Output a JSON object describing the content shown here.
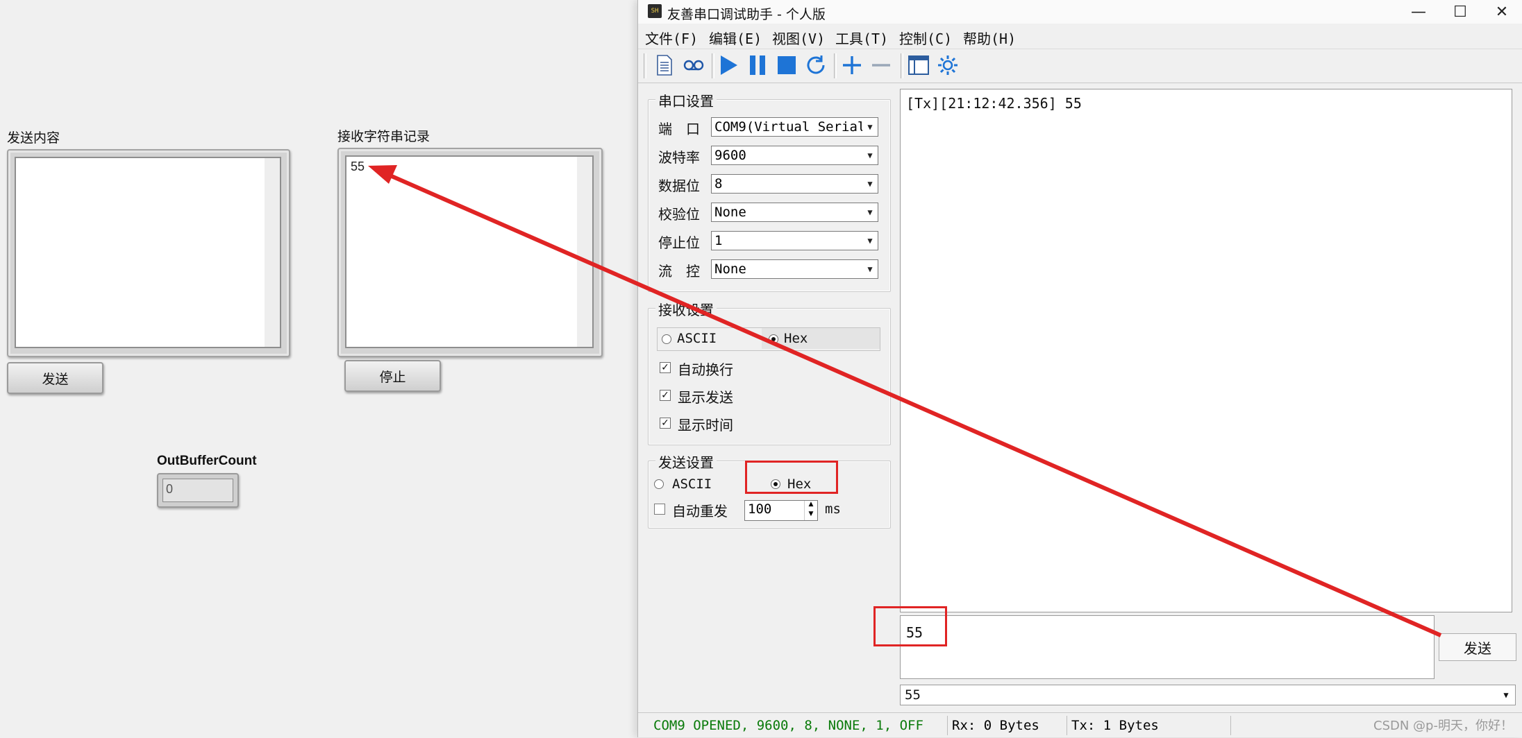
{
  "labview": {
    "send_content_label": "发送内容",
    "recv_log_label": "接收字符串记录",
    "recv_log_text": "55",
    "send_button": "发送",
    "stop_button": "停止",
    "out_buffer_label": "OutBufferCount",
    "out_buffer_value": "0"
  },
  "window": {
    "title": "友善串口调试助手 - 个人版",
    "icon_text": "SH",
    "controls": {
      "minimize": "—",
      "maximize": "☐",
      "close": "✕"
    }
  },
  "menu": [
    "文件(F)",
    "编辑(E)",
    "视图(V)",
    "工具(T)",
    "控制(C)",
    "帮助(H)"
  ],
  "toolbar_icons": [
    "new-file-icon",
    "loop-icon",
    "play-icon",
    "pause-icon",
    "stop-icon",
    "refresh-icon",
    "add-icon",
    "remove-icon",
    "window-icon",
    "settings-icon"
  ],
  "serial_settings": {
    "title": "串口设置",
    "port_label": "端　口",
    "port_value": "COM9(Virtual Serial",
    "baud_label": "波特率",
    "baud_value": "9600",
    "databits_label": "数据位",
    "databits_value": "8",
    "parity_label": "校验位",
    "parity_value": "None",
    "stopbits_label": "停止位",
    "stopbits_value": "1",
    "flow_label": "流　控",
    "flow_value": "None"
  },
  "recv_settings": {
    "title": "接收设置",
    "ascii": "ASCII",
    "hex": "Hex",
    "selected": "Hex",
    "auto_wrap": "自动换行",
    "show_send": "显示发送",
    "show_time": "显示时间",
    "auto_wrap_checked": true,
    "show_send_checked": true,
    "show_time_checked": true
  },
  "send_settings": {
    "title": "发送设置",
    "ascii": "ASCII",
    "hex": "Hex",
    "selected": "Hex",
    "auto_resend": "自动重发",
    "auto_resend_checked": false,
    "interval": "100",
    "unit": "ms"
  },
  "receive_log": "[Tx][21:12:42.356] 55",
  "send_text": "55",
  "send_button": "发送",
  "history_value": "55",
  "status": {
    "port_state": "COM9 OPENED, 9600, 8, NONE, 1, OFF",
    "rx": "Rx: 0 Bytes",
    "tx": "Tx: 1 Bytes"
  },
  "watermark": "CSDN @p-明天，你好！",
  "colors": {
    "status_green": "#0a7a0a",
    "toolbar_blue": "#1e74d6",
    "annotation_red": "#e02424"
  }
}
